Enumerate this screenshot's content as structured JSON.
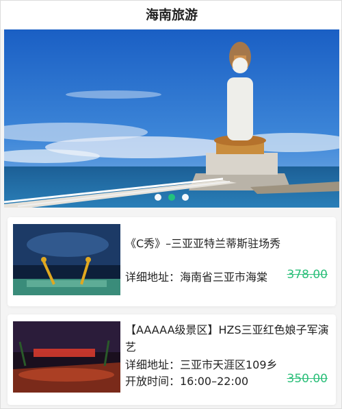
{
  "header": {
    "title": "海南旅游"
  },
  "banner": {
    "image": "guanyin-statue-sanya-photo",
    "dots": [
      {
        "active": false
      },
      {
        "active": true
      },
      {
        "active": false
      }
    ],
    "accent_color": "#22c67a"
  },
  "items": [
    {
      "title": "《C秀》–三亚亚特兰蒂斯驻场秀",
      "address": "详细地址：海南省三亚市海棠",
      "price": "378.00",
      "image": "c-show-stage-photo"
    },
    {
      "title": "【AAAAA级景区】HZS三亚红色娘子军演艺",
      "address": "详细地址：三亚市天涯区109乡",
      "hours": "开放时间：16:00–22:00",
      "price": "350.00",
      "image": "red-detachment-show-photo"
    }
  ],
  "colors": {
    "price": "#2cbf7a",
    "background": "#f4f4f4"
  }
}
